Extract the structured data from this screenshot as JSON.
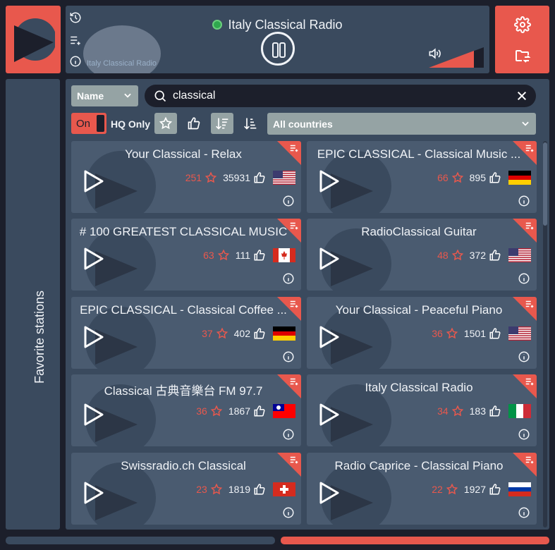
{
  "player": {
    "station_name": "Italy Classical Radio",
    "art_text": "Italy Classical Radio",
    "status_color": "#2fa84e",
    "volume_level": 1.0
  },
  "sidebar": {
    "favorites_label": "Favorite stations"
  },
  "search": {
    "sort_by": "Name",
    "query": "classical",
    "hq_toggle": "On",
    "hq_label": "HQ Only",
    "country": "All countries"
  },
  "colors": {
    "accent": "#e8584d",
    "panel": "#3a4a5e",
    "card": "#4a5b70",
    "bg": "#1c1f2b"
  },
  "stations": [
    {
      "name": "Your Classical - Relax",
      "votes": "251",
      "clicks": "35931",
      "flag": "us"
    },
    {
      "name": "EPIC CLASSICAL - Classical Music ...",
      "votes": "66",
      "clicks": "895",
      "flag": "de"
    },
    {
      "name": "# 100 GREATEST CLASSICAL MUSIC",
      "votes": "63",
      "clicks": "111",
      "flag": "ca"
    },
    {
      "name": "RadioClassical Guitar",
      "votes": "48",
      "clicks": "372",
      "flag": "us"
    },
    {
      "name": "EPIC CLASSICAL - Classical Coffee ...",
      "votes": "37",
      "clicks": "402",
      "flag": "de"
    },
    {
      "name": "Your Classical - Peaceful Piano",
      "votes": "36",
      "clicks": "1501",
      "flag": "us"
    },
    {
      "name": "Classical 古典音樂台 FM 97.7",
      "votes": "36",
      "clicks": "1867",
      "flag": "tw"
    },
    {
      "name": "Italy Classical Radio",
      "votes": "34",
      "clicks": "183",
      "flag": "it"
    },
    {
      "name": "Swissradio.ch Classical",
      "votes": "23",
      "clicks": "1819",
      "flag": "ch"
    },
    {
      "name": "Radio Caprice - Classical Piano",
      "votes": "22",
      "clicks": "1927",
      "flag": "ru"
    }
  ],
  "icons": {
    "history": "history-icon",
    "queue": "playlist-add-icon",
    "info": "info-icon",
    "settings": "gear-icon",
    "folder": "folder-sync-icon",
    "volume": "volume-icon",
    "search": "search-icon",
    "clear": "close-icon",
    "star": "star-icon",
    "thumb": "thumbs-up-icon",
    "sort_desc": "sort-descending-icon",
    "sort_asc": "sort-ascending-icon"
  }
}
